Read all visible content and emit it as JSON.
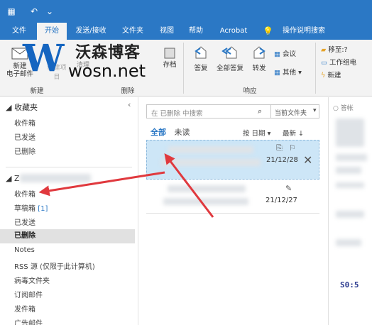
{
  "menu": {
    "tabs": [
      "文件",
      "开始",
      "发送/接收",
      "文件夹",
      "视图",
      "帮助",
      "Acrobat"
    ],
    "active_tab": "开始",
    "tell_me": "操作说明搜索"
  },
  "ribbon": {
    "new_email": "新建\n电子邮件",
    "new_items_partial": "新建项目",
    "clean": "清理",
    "delete_partial": "删除",
    "archive": "存档",
    "reply": "答复",
    "reply_all": "全部答复",
    "forward": "转发",
    "meeting": "会议",
    "more": "其他",
    "move_to": "移至:?",
    "to_manager": "工作组电",
    "new": "新建",
    "group_new": "新建",
    "group_delete": "删除",
    "group_respond": "响应"
  },
  "watermark": {
    "title": "沃森博客",
    "url": "wosn.net"
  },
  "nav": {
    "favorites_header": "收藏夹",
    "favorites": [
      "收件箱",
      "已发送",
      "已删除"
    ],
    "account_prefix": "Z",
    "folders": [
      {
        "label": "收件箱"
      },
      {
        "label": "草稿箱",
        "badge": "[1]"
      },
      {
        "label": "已发送"
      },
      {
        "label": "已删除",
        "selected": true
      },
      {
        "label": "Notes"
      },
      {
        "label": "RSS 源 (仅限于此计算机)"
      },
      {
        "label": "病毒文件夹"
      },
      {
        "label": "订阅邮件"
      },
      {
        "label": "发件箱"
      },
      {
        "label": "广告邮件"
      }
    ]
  },
  "list": {
    "search_placeholder": "在 已删除 中搜索",
    "scope": "当前文件夹",
    "filter_all": "全部",
    "filter_unread": "未读",
    "sort_by": "按 日期",
    "sort_order": "最新",
    "items": [
      {
        "date": "21/12/28",
        "selected": true
      },
      {
        "date": "21/12/27",
        "selected": false
      }
    ]
  },
  "reading": {
    "header_partial": "答帐",
    "snippet": "S0:5"
  },
  "colors": {
    "accent": "#2b78c5",
    "arrow": "#e0393e",
    "selected_mail": "#cde6f7"
  }
}
